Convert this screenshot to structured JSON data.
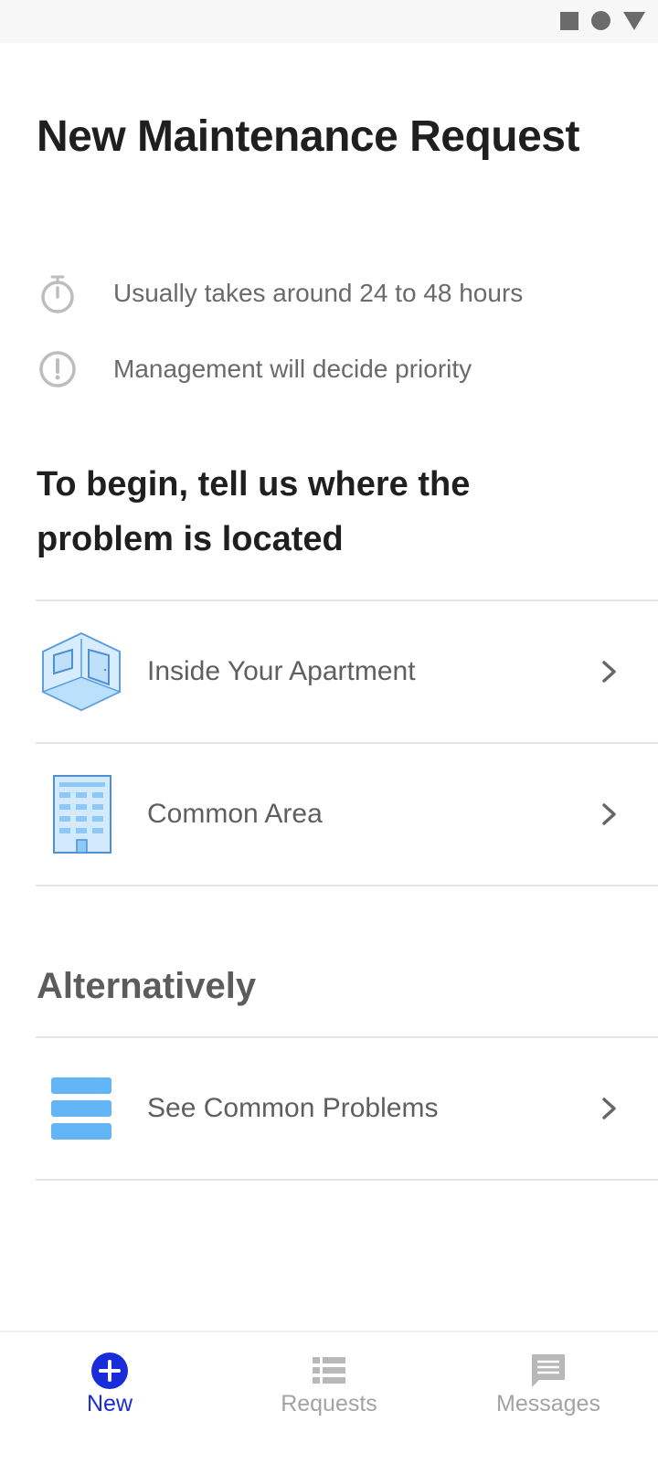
{
  "page": {
    "title": "New Maintenance Request",
    "info": [
      {
        "icon": "stopwatch-icon",
        "text": "Usually takes around 24 to 48 hours"
      },
      {
        "icon": "exclamation-circle-icon",
        "text": "Management will decide priority"
      }
    ],
    "location_heading": "To begin, tell us where the problem is located",
    "locations": [
      {
        "icon": "apartment-room-icon",
        "label": "Inside Your Apartment"
      },
      {
        "icon": "building-icon",
        "label": "Common Area"
      }
    ],
    "alternative_heading": "Alternatively",
    "alternatives": [
      {
        "icon": "list-stack-icon",
        "label": "See Common Problems"
      }
    ]
  },
  "bottom_nav": {
    "tabs": [
      {
        "label": "New",
        "icon": "plus-circle-icon",
        "active": true
      },
      {
        "label": "Requests",
        "icon": "list-icon",
        "active": false
      },
      {
        "label": "Messages",
        "icon": "message-icon",
        "active": false
      }
    ]
  },
  "colors": {
    "accent": "#1a2bd9",
    "icon_blue": "#64b5f6",
    "text_dark": "#1f1f1f",
    "text_muted": "#6a6a6a"
  }
}
